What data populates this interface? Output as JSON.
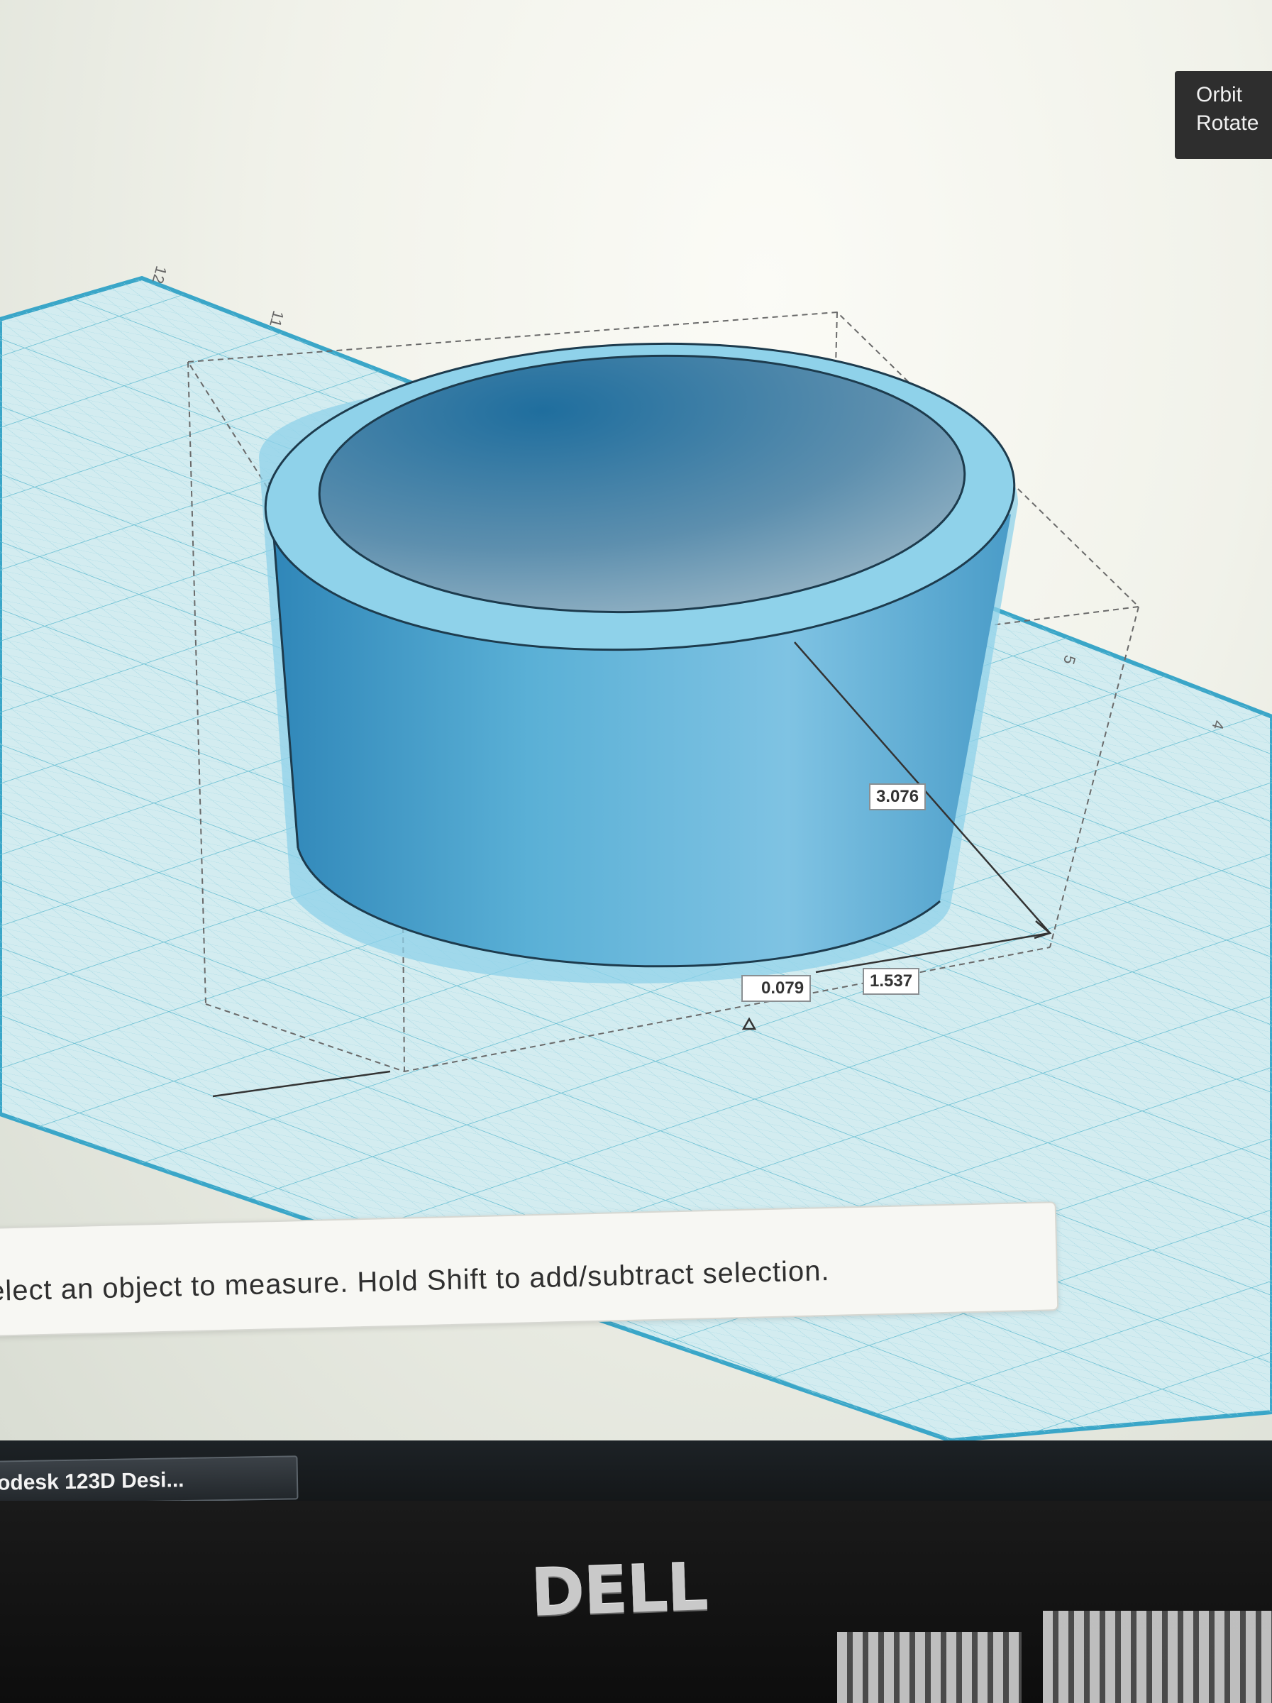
{
  "app": {
    "taskbar_title": "odesk 123D Desi..."
  },
  "view_tooltip": {
    "line1": "Orbit",
    "line2": "Rotate"
  },
  "grid_labels": {
    "a": "12",
    "b": "11",
    "c": "5",
    "d": "4"
  },
  "dimensions": {
    "diagonal": "3.076",
    "small": "0.079",
    "width": "1.537"
  },
  "hint": {
    "text": "elect an object to measure. Hold Shift to add/subtract selection."
  },
  "monitor": {
    "brand": "DELL"
  },
  "colors": {
    "grid_bg": "#d3ecf0",
    "grid_line": "#7fc6d6",
    "object": "#4a9fc8",
    "object_highlight": "#8fd2ea"
  }
}
